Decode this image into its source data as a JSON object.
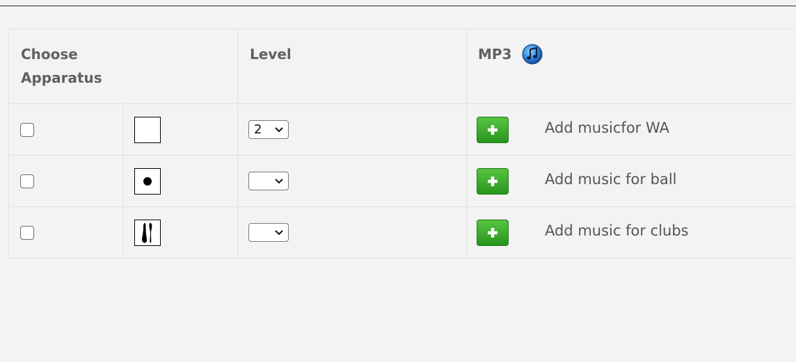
{
  "table": {
    "headers": {
      "apparatus": "Choose Apparatus",
      "level": "Level",
      "mp3": "MP3"
    },
    "rows": [
      {
        "apparatus": "without-apparatus",
        "icon": "blank-square-icon",
        "level": "2",
        "add_label": "Add musicfor WA",
        "checked": false
      },
      {
        "apparatus": "ball",
        "icon": "ball-icon",
        "level": "",
        "add_label": "Add music for ball",
        "checked": false
      },
      {
        "apparatus": "clubs",
        "icon": "clubs-icon",
        "level": "",
        "add_label": "Add music for clubs",
        "checked": false
      }
    ]
  },
  "colors": {
    "add_button": "#34a528",
    "background": "#f3f3f3",
    "header_text": "#606060"
  }
}
